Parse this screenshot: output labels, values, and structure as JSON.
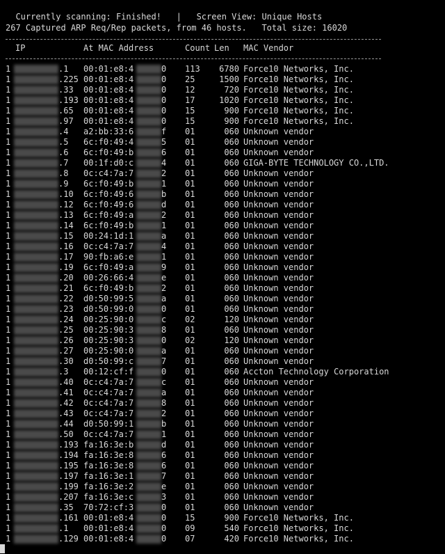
{
  "status": {
    "scanning_label": "Currently scanning: Finished!",
    "separator": "|",
    "view_label": "Screen View: Unique Hosts"
  },
  "summary": "267 Captured ARP Req/Rep packets, from 46 hosts.   Total size: 16020",
  "columns": {
    "ip": "IP",
    "mac": "At MAC Address",
    "count": "Count",
    "len": "Len",
    "vendor": "MAC Vendor"
  },
  "rows": [
    {
      "ip": ".1",
      "mac": "00:01:e8:4",
      "mac_end": "0",
      "count": "113",
      "len": "6780",
      "vendor": "Force10 Networks, Inc."
    },
    {
      "ip": ".225",
      "mac": "00:01:e8:4",
      "mac_end": "0",
      "count": "25",
      "len": "1500",
      "vendor": "Force10 Networks, Inc."
    },
    {
      "ip": ".33",
      "mac": "00:01:e8:4",
      "mac_end": "0",
      "count": "12",
      "len": "720",
      "vendor": "Force10 Networks, Inc."
    },
    {
      "ip": ".193",
      "mac": "00:01:e8:4",
      "mac_end": "0",
      "count": "17",
      "len": "1020",
      "vendor": "Force10 Networks, Inc."
    },
    {
      "ip": ".65",
      "mac": "00:01:e8:4",
      "mac_end": "0",
      "count": "15",
      "len": "900",
      "vendor": "Force10 Networks, Inc."
    },
    {
      "ip": ".97",
      "mac": "00:01:e8:4",
      "mac_end": "0",
      "count": "15",
      "len": "900",
      "vendor": "Force10 Networks, Inc."
    },
    {
      "ip": ".4",
      "mac": "a2:bb:33:6",
      "mac_end": "f",
      "count": "01",
      "len": "060",
      "vendor": "Unknown vendor"
    },
    {
      "ip": ".5",
      "mac": "6c:f0:49:4",
      "mac_end": "5",
      "count": "01",
      "len": "060",
      "vendor": "Unknown vendor"
    },
    {
      "ip": ".6",
      "mac": "6c:f0:49:b",
      "mac_end": "6",
      "count": "01",
      "len": "060",
      "vendor": "Unknown vendor"
    },
    {
      "ip": ".7",
      "mac": "00:1f:d0:c",
      "mac_end": "4",
      "count": "01",
      "len": "060",
      "vendor": "GIGA-BYTE TECHNOLOGY CO.,LTD."
    },
    {
      "ip": ".8",
      "mac": "0c:c4:7a:7",
      "mac_end": "2",
      "count": "01",
      "len": "060",
      "vendor": "Unknown vendor"
    },
    {
      "ip": ".9",
      "mac": "6c:f0:49:b",
      "mac_end": "1",
      "count": "01",
      "len": "060",
      "vendor": "Unknown vendor"
    },
    {
      "ip": ".10",
      "mac": "6c:f0:49:6",
      "mac_end": "b",
      "count": "01",
      "len": "060",
      "vendor": "Unknown vendor"
    },
    {
      "ip": ".12",
      "mac": "6c:f0:49:6",
      "mac_end": "d",
      "count": "01",
      "len": "060",
      "vendor": "Unknown vendor"
    },
    {
      "ip": ".13",
      "mac": "6c:f0:49:a",
      "mac_end": "2",
      "count": "01",
      "len": "060",
      "vendor": "Unknown vendor"
    },
    {
      "ip": ".14",
      "mac": "6c:f0:49:b",
      "mac_end": "1",
      "count": "01",
      "len": "060",
      "vendor": "Unknown vendor"
    },
    {
      "ip": ".15",
      "mac": "00:24:1d:1",
      "mac_end": "a",
      "count": "01",
      "len": "060",
      "vendor": "Unknown vendor"
    },
    {
      "ip": ".16",
      "mac": "0c:c4:7a:7",
      "mac_end": "4",
      "count": "01",
      "len": "060",
      "vendor": "Unknown vendor"
    },
    {
      "ip": ".17",
      "mac": "90:fb:a6:e",
      "mac_end": "1",
      "count": "01",
      "len": "060",
      "vendor": "Unknown vendor"
    },
    {
      "ip": ".19",
      "mac": "6c:f0:49:a",
      "mac_end": "9",
      "count": "01",
      "len": "060",
      "vendor": "Unknown vendor"
    },
    {
      "ip": ".20",
      "mac": "00:26:66:4",
      "mac_end": "e",
      "count": "01",
      "len": "060",
      "vendor": "Unknown vendor"
    },
    {
      "ip": ".21",
      "mac": "6c:f0:49:b",
      "mac_end": "2",
      "count": "01",
      "len": "060",
      "vendor": "Unknown vendor"
    },
    {
      "ip": ".22",
      "mac": "d0:50:99:5",
      "mac_end": "a",
      "count": "01",
      "len": "060",
      "vendor": "Unknown vendor"
    },
    {
      "ip": ".23",
      "mac": "d0:50:99:0",
      "mac_end": "0",
      "count": "01",
      "len": "060",
      "vendor": "Unknown vendor"
    },
    {
      "ip": ".24",
      "mac": "00:25:90:0",
      "mac_end": "c",
      "count": "02",
      "len": "120",
      "vendor": "Unknown vendor"
    },
    {
      "ip": ".25",
      "mac": "00:25:90:3",
      "mac_end": "8",
      "count": "01",
      "len": "060",
      "vendor": "Unknown vendor"
    },
    {
      "ip": ".26",
      "mac": "00:25:90:3",
      "mac_end": "0",
      "count": "02",
      "len": "120",
      "vendor": "Unknown vendor"
    },
    {
      "ip": ".27",
      "mac": "00:25:90:0",
      "mac_end": "a",
      "count": "01",
      "len": "060",
      "vendor": "Unknown vendor"
    },
    {
      "ip": ".30",
      "mac": "d0:50:99:c",
      "mac_end": "7",
      "count": "01",
      "len": "060",
      "vendor": "Unknown vendor"
    },
    {
      "ip": ".3",
      "mac": "00:12:cf:f",
      "mac_end": "0",
      "count": "01",
      "len": "060",
      "vendor": "Accton Technology Corporation"
    },
    {
      "ip": ".40",
      "mac": "0c:c4:7a:7",
      "mac_end": "c",
      "count": "01",
      "len": "060",
      "vendor": "Unknown vendor"
    },
    {
      "ip": ".41",
      "mac": "0c:c4:7a:7",
      "mac_end": "a",
      "count": "01",
      "len": "060",
      "vendor": "Unknown vendor"
    },
    {
      "ip": ".42",
      "mac": "0c:c4:7a:7",
      "mac_end": "8",
      "count": "01",
      "len": "060",
      "vendor": "Unknown vendor"
    },
    {
      "ip": ".43",
      "mac": "0c:c4:7a:7",
      "mac_end": "2",
      "count": "01",
      "len": "060",
      "vendor": "Unknown vendor"
    },
    {
      "ip": ".44",
      "mac": "d0:50:99:1",
      "mac_end": "b",
      "count": "01",
      "len": "060",
      "vendor": "Unknown vendor"
    },
    {
      "ip": ".50",
      "mac": "0c:c4:7a:7",
      "mac_end": "1",
      "count": "01",
      "len": "060",
      "vendor": "Unknown vendor"
    },
    {
      "ip": ".193",
      "mac": "fa:16:3e:b",
      "mac_end": "d",
      "count": "01",
      "len": "060",
      "vendor": "Unknown vendor"
    },
    {
      "ip": ".194",
      "mac": "fa:16:3e:8",
      "mac_end": "6",
      "count": "01",
      "len": "060",
      "vendor": "Unknown vendor"
    },
    {
      "ip": ".195",
      "mac": "fa:16:3e:8",
      "mac_end": "6",
      "count": "01",
      "len": "060",
      "vendor": "Unknown vendor"
    },
    {
      "ip": ".197",
      "mac": "fa:16:3e:1",
      "mac_end": "7",
      "count": "01",
      "len": "060",
      "vendor": "Unknown vendor"
    },
    {
      "ip": ".199",
      "mac": "fa:16:3e:2",
      "mac_end": "e",
      "count": "01",
      "len": "060",
      "vendor": "Unknown vendor"
    },
    {
      "ip": ".207",
      "mac": "fa:16:3e:c",
      "mac_end": "3",
      "count": "01",
      "len": "060",
      "vendor": "Unknown vendor"
    },
    {
      "ip": ".35",
      "mac": "70:72:cf:3",
      "mac_end": "0",
      "count": "01",
      "len": "060",
      "vendor": "Unknown vendor"
    },
    {
      "ip": ".161",
      "mac": "00:01:e8:4",
      "mac_end": "0",
      "count": "15",
      "len": "900",
      "vendor": "Force10 Networks, Inc."
    },
    {
      "ip": ".1",
      "mac": "00:01:e8:4",
      "mac_end": "0",
      "count": "09",
      "len": "540",
      "vendor": "Force10 Networks, Inc."
    },
    {
      "ip": ".129",
      "mac": "00:01:e8:4",
      "mac_end": "0",
      "count": "07",
      "len": "420",
      "vendor": "Force10 Networks, Inc."
    }
  ],
  "ip_prefix_char": "1",
  "colors": {
    "background": "#000000",
    "foreground": "#d9d9d9",
    "redaction": "#4a4a4a"
  }
}
